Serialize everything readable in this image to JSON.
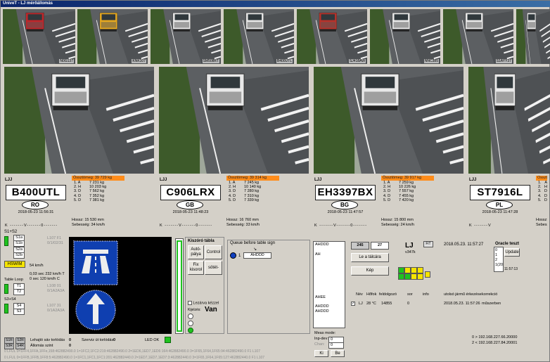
{
  "window": {
    "title": "UniveT - LJ mérőállomás"
  },
  "thumbnails": [
    {
      "label": "N0G137",
      "truck": "#c0262a"
    },
    {
      "label": "KNK107",
      "truck": "#e6a81f"
    },
    {
      "label": "SM508RT",
      "truck": "#e8e8e8"
    },
    {
      "label": "B400UTL",
      "truck": "#e8e8e8"
    },
    {
      "label": "SJ418AW",
      "truck": "#b8322a"
    },
    {
      "label": "NNC385",
      "truck": "#e8e8e8"
    },
    {
      "label": "S1AYY37",
      "truck": "#e8e8e8"
    },
    {
      "label": "",
      "truck": "#e8e8e8"
    }
  ],
  "lanes": [
    {
      "lane": "LJJ",
      "plate": "B400UTL",
      "country": "RO",
      "time": "2018-05-23 11:56:31",
      "weight_header": "Össztömeg: 39 729 kg",
      "axles": [
        [
          "1. A",
          "7 231 kg"
        ],
        [
          "2. H",
          "10 203 kg"
        ],
        [
          "3. D",
          "7 562 kg"
        ],
        [
          "4. D",
          "7 352 kg"
        ],
        [
          "5. D",
          "7 381 kg"
        ]
      ],
      "length": "Hossz:      15 530 mm",
      "speed": "Sebesség: 34 km/h",
      "kv": "K -------V-------0-------"
    },
    {
      "lane": "LJJ",
      "plate": "C906LRX",
      "country": "GB",
      "time": "2018-05-23 11:48:23",
      "weight_header": "Össztömeg: 39 314 kg",
      "axles": [
        [
          "1. A",
          "7 245 kg"
        ],
        [
          "2. H",
          "10 140 kg"
        ],
        [
          "3. D",
          "7 280 kg"
        ],
        [
          "4. D",
          "7 310 kg"
        ],
        [
          "5. D",
          "7 339 kg"
        ]
      ],
      "length": "Hossz:      16 760 mm",
      "speed": "Sebesség: 33 km/h",
      "kv": "K -------V-------0-------"
    },
    {
      "lane": "LJJ",
      "plate": "EH3397BX",
      "country": "BG",
      "time": "2018-05-23 11:47:57",
      "weight_header": "Össztömeg: 39 917 kg",
      "axles": [
        [
          "1. A",
          "7 259 kg"
        ],
        [
          "2. H",
          "10 226 kg"
        ],
        [
          "3. D",
          "7 557 kg"
        ],
        [
          "4. D",
          "7 455 kg"
        ],
        [
          "5. D",
          "7 420 kg"
        ]
      ],
      "length": "Hossz:      15 800 mm",
      "speed": "Sebesség: 24 km/h",
      "kv": "K -------V-------0-------"
    },
    {
      "lane": "LJJ",
      "plate": "ST7916L",
      "country": "PL",
      "time": "2018-05-23 11:47:28",
      "weight_header": "Össztömeg",
      "axles": [
        [
          "1.",
          "A"
        ],
        [
          "2.",
          "H"
        ],
        [
          "3.",
          "D"
        ],
        [
          "4.",
          "D"
        ],
        [
          "5.",
          "D"
        ]
      ],
      "length": "Hossz:",
      "speed": "Sebesség",
      "kv": "K -------V"
    }
  ],
  "sensors": {
    "s1s2": "S1+S2",
    "s1a": "S1a",
    "s1b": "S1b",
    "s2a": "S2a",
    "s2b": "S2b",
    "l107a": "L107 F1",
    "l107a2": "0/1/02/31",
    "hswim": "HSWIM",
    "hswim_speed": "54 km/h",
    "line1": "0,03 sec 232 km/h  T",
    "line2": "0 sec 120 km/h  C",
    "table_loop": "Table Loop",
    "t1": "T1",
    "t2": "T2",
    "l108": "L108 01",
    "l108b": "0/1A2A3A",
    "s3s4": "S3+S4",
    "s4": "S4",
    "s3": "S3",
    "l107b": "L107 31",
    "l107b2": "0/1A2A3A"
  },
  "bottom_left": {
    "s1r": "S1R",
    "s2r": "S2R",
    "s3r": "S3R",
    "s4r": "S4R",
    "lehajto": "Lehajtó sáv torlódás",
    "lehajto_val": "0",
    "szerviz": "Szerviz út torlódás",
    "szerviz_val": "0",
    "allomas": "Állomás szint",
    "allomas_val": "0",
    "led_ok": "LED OK",
    "log1": "0 LFUL 0=1FF4,1FFA,1FFe,158:462882490.0 1=1FC2,1FC2:219:462882490.0 2=1ED6,1ED7,1ED6:164:462882490.0 3=1F65,1F64,1F65:94:462882490.0 F1 L107",
    "log2": "0 LFUL 0=1FFB,1FFB,1FF8:5:462882490.0 1=1FC1,1FC1,1FC1:201:462882440.0 2=1ED7,1ED7,1ED7:3:462882440.0 3=1F65,1F64,1F65:127:462882440.0 F1 L107"
  },
  "control": {
    "title": "Kiszóró tábla",
    "auto": "Autó-pálya",
    "control": "Control",
    "fix": "Fix kisorol",
    "sotet": "sötét-",
    "lezarva": "Lezárva kézzel",
    "kijelzes": "Kijelzés:",
    "van": "Van"
  },
  "queue": {
    "title": "Queue before table sign",
    "num": "1",
    "item": "AHDDD"
  },
  "list1": [
    "AHDDD",
    "",
    "AH",
    "",
    "",
    "",
    "",
    "",
    "",
    "",
    "",
    "AHEE",
    "",
    "AHDDD",
    "AHDDD"
  ],
  "meas": {
    "mode": "Meas mode:",
    "inp": "Inp-dev:",
    "chan": "Chan:",
    "inp_val": "0",
    "chan_val": "0",
    "ki": "Ki",
    "be": "Be"
  },
  "right": {
    "n245": "245",
    "n27": "27",
    "le_a_talcara": "Le a tálcára",
    "kep": "Kép",
    "lj": "LJ",
    "v347k": "v347k",
    "fit": "FiT",
    "date": "2018.05.23. 11:57:27",
    "oracle": "Oracle teszt",
    "update": "Update",
    "oracle_opts": [
      "0",
      "1",
      "2",
      "1(20)"
    ],
    "oracle_time": "11:57:13",
    "hdr": [
      "Név",
      "Hőfok",
      "feldolgozó",
      "sor",
      "info",
      "utolsó jármű érkezése",
      "korrekció"
    ],
    "row": [
      "LJ",
      "28 °C",
      "14855",
      "0",
      "",
      "2018.05.23. 11:57:26",
      "műszerben"
    ],
    "ip1": "0 > 192.168.227.66.20000",
    "ip2": "2 < 192.168.227.84.20001"
  }
}
